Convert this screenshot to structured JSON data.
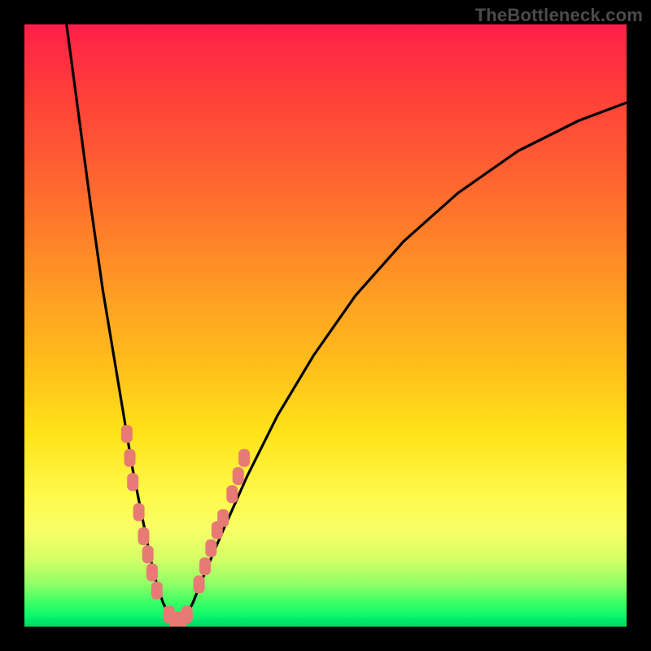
{
  "attribution": "TheBottleneck.com",
  "colors": {
    "frame": "#000000",
    "curve": "#000000",
    "markers": "#e77a75",
    "gradient_top": "#ff1f4a",
    "gradient_bottom": "#02d765"
  },
  "chart_data": {
    "type": "line",
    "title": "",
    "xlabel": "",
    "ylabel": "",
    "xlim": [
      0,
      100
    ],
    "ylim": [
      0,
      100
    ],
    "series": [
      {
        "name": "bottleneck-curve",
        "x": [
          7,
          9,
          11,
          13,
          15,
          17,
          18,
          19,
          20,
          21,
          22,
          23,
          24,
          25.5,
          27,
          28,
          30,
          33,
          37,
          42,
          48,
          55,
          63,
          72,
          82,
          92,
          100
        ],
        "y": [
          100,
          85,
          70,
          56,
          44,
          32,
          26,
          21,
          16,
          11,
          7,
          4,
          2,
          1,
          2,
          4,
          9,
          16,
          25,
          35,
          45,
          55,
          64,
          72,
          79,
          84,
          87
        ]
      }
    ],
    "markers": [
      {
        "name": "left-cluster",
        "points": [
          {
            "x": 17.0,
            "y": 32
          },
          {
            "x": 17.5,
            "y": 28
          },
          {
            "x": 18.0,
            "y": 24
          },
          {
            "x": 19.0,
            "y": 19
          },
          {
            "x": 19.8,
            "y": 15
          },
          {
            "x": 20.5,
            "y": 12
          },
          {
            "x": 21.2,
            "y": 9
          },
          {
            "x": 22.0,
            "y": 6
          }
        ]
      },
      {
        "name": "bottom-cluster",
        "points": [
          {
            "x": 24.0,
            "y": 2
          },
          {
            "x": 25.0,
            "y": 1
          },
          {
            "x": 26.0,
            "y": 1
          },
          {
            "x": 27.0,
            "y": 2
          }
        ]
      },
      {
        "name": "right-cluster",
        "points": [
          {
            "x": 29.0,
            "y": 7
          },
          {
            "x": 30.0,
            "y": 10
          },
          {
            "x": 31.0,
            "y": 13
          },
          {
            "x": 32.0,
            "y": 16
          },
          {
            "x": 33.0,
            "y": 18
          },
          {
            "x": 34.5,
            "y": 22
          },
          {
            "x": 35.5,
            "y": 25
          },
          {
            "x": 36.5,
            "y": 28
          }
        ]
      }
    ]
  }
}
